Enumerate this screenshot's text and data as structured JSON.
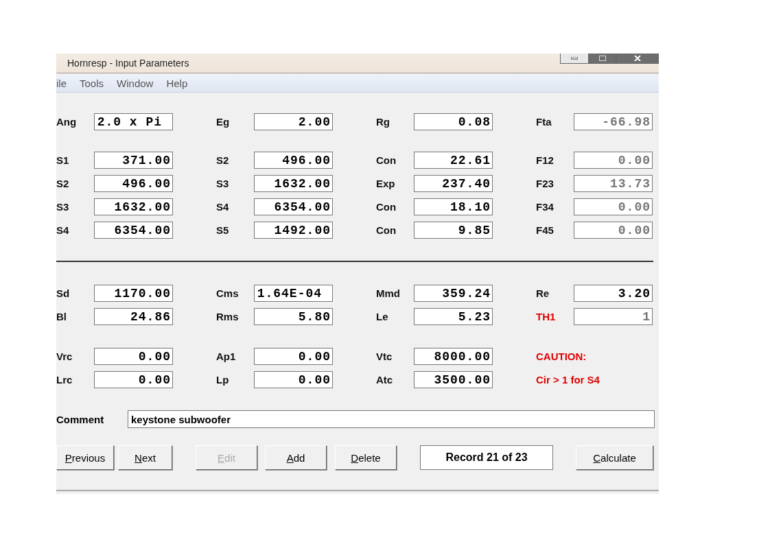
{
  "window": {
    "title": "Hornresp - Input Parameters"
  },
  "menu": [
    "ile",
    "Tools",
    "Window",
    "Help"
  ],
  "top_groups": [
    [
      [
        {
          "kind": "left_field",
          "label": "Ang",
          "value": "2.0 x Pi",
          "readonly": false
        },
        {
          "kind": "field",
          "label": "Eg",
          "value": "2.00",
          "readonly": false
        },
        {
          "kind": "field",
          "label": "Rg",
          "value": "0.08",
          "readonly": false
        },
        {
          "kind": "field",
          "label": "Fta",
          "value": "-66.98",
          "readonly": true
        }
      ]
    ],
    [
      [
        {
          "kind": "field",
          "label": "S1",
          "value": "371.00",
          "readonly": false
        },
        {
          "kind": "field",
          "label": "S2",
          "value": "496.00",
          "readonly": false
        },
        {
          "kind": "field",
          "label": "Con",
          "value": "22.61",
          "readonly": false
        },
        {
          "kind": "field",
          "label": "F12",
          "value": "0.00",
          "readonly": true
        }
      ],
      [
        {
          "kind": "field",
          "label": "S2",
          "value": "496.00",
          "readonly": false
        },
        {
          "kind": "field",
          "label": "S3",
          "value": "1632.00",
          "readonly": false
        },
        {
          "kind": "field",
          "label": "Exp",
          "value": "237.40",
          "readonly": false
        },
        {
          "kind": "field",
          "label": "F23",
          "value": "13.73",
          "readonly": true
        }
      ],
      [
        {
          "kind": "field",
          "label": "S3",
          "value": "1632.00",
          "readonly": false
        },
        {
          "kind": "field",
          "label": "S4",
          "value": "6354.00",
          "readonly": false
        },
        {
          "kind": "field",
          "label": "Con",
          "value": "18.10",
          "readonly": false
        },
        {
          "kind": "field",
          "label": "F34",
          "value": "0.00",
          "readonly": true
        }
      ],
      [
        {
          "kind": "field",
          "label": "S4",
          "value": "6354.00",
          "readonly": false
        },
        {
          "kind": "field",
          "label": "S5",
          "value": "1492.00",
          "readonly": false
        },
        {
          "kind": "field",
          "label": "Con",
          "value": "9.85",
          "readonly": false
        },
        {
          "kind": "field",
          "label": "F45",
          "value": "0.00",
          "readonly": true
        }
      ]
    ]
  ],
  "bottom_groups": [
    [
      [
        {
          "kind": "field",
          "label": "Sd",
          "value": "1170.00",
          "readonly": false
        },
        {
          "kind": "left_field",
          "label": "Cms",
          "value": "1.64E-04",
          "readonly": false
        },
        {
          "kind": "field",
          "label": "Mmd",
          "value": "359.24",
          "readonly": false
        },
        {
          "kind": "field",
          "label": "Re",
          "value": "3.20",
          "readonly": false
        }
      ],
      [
        {
          "kind": "field",
          "label": "Bl",
          "value": "24.86",
          "readonly": false
        },
        {
          "kind": "field",
          "label": "Rms",
          "value": "5.80",
          "readonly": false
        },
        {
          "kind": "field",
          "label": "Le",
          "value": "5.23",
          "readonly": false
        },
        {
          "kind": "field",
          "label": "TH1",
          "label_warning": true,
          "value": "1",
          "readonly": true
        }
      ]
    ],
    [
      [
        {
          "kind": "field",
          "label": "Vrc",
          "value": "0.00",
          "readonly": false
        },
        {
          "kind": "field",
          "label": "Ap1",
          "value": "0.00",
          "readonly": false
        },
        {
          "kind": "field",
          "label": "Vtc",
          "value": "8000.00",
          "readonly": false
        },
        {
          "kind": "warning",
          "text": "CAUTION:"
        }
      ],
      [
        {
          "kind": "field",
          "label": "Lrc",
          "value": "0.00",
          "readonly": false
        },
        {
          "kind": "field",
          "label": "Lp",
          "value": "0.00",
          "readonly": false
        },
        {
          "kind": "field",
          "label": "Atc",
          "value": "3500.00",
          "readonly": false
        },
        {
          "kind": "warning",
          "text": "Cir > 1 for S4"
        }
      ]
    ]
  ],
  "comment": {
    "label": "Comment",
    "value": "keystone subwoofer"
  },
  "buttons": [
    {
      "accel": "P",
      "rest": "revious",
      "disabled": false
    },
    {
      "accel": "N",
      "rest": "ext",
      "disabled": false
    },
    {
      "accel": "E",
      "rest": "dit",
      "disabled": true
    },
    {
      "accel": "A",
      "rest": "dd",
      "disabled": false
    },
    {
      "accel": "D",
      "rest": "elete",
      "disabled": false
    }
  ],
  "record": "Record 21 of 23",
  "calculate": {
    "accel": "C",
    "rest": "alculate",
    "disabled": false
  }
}
